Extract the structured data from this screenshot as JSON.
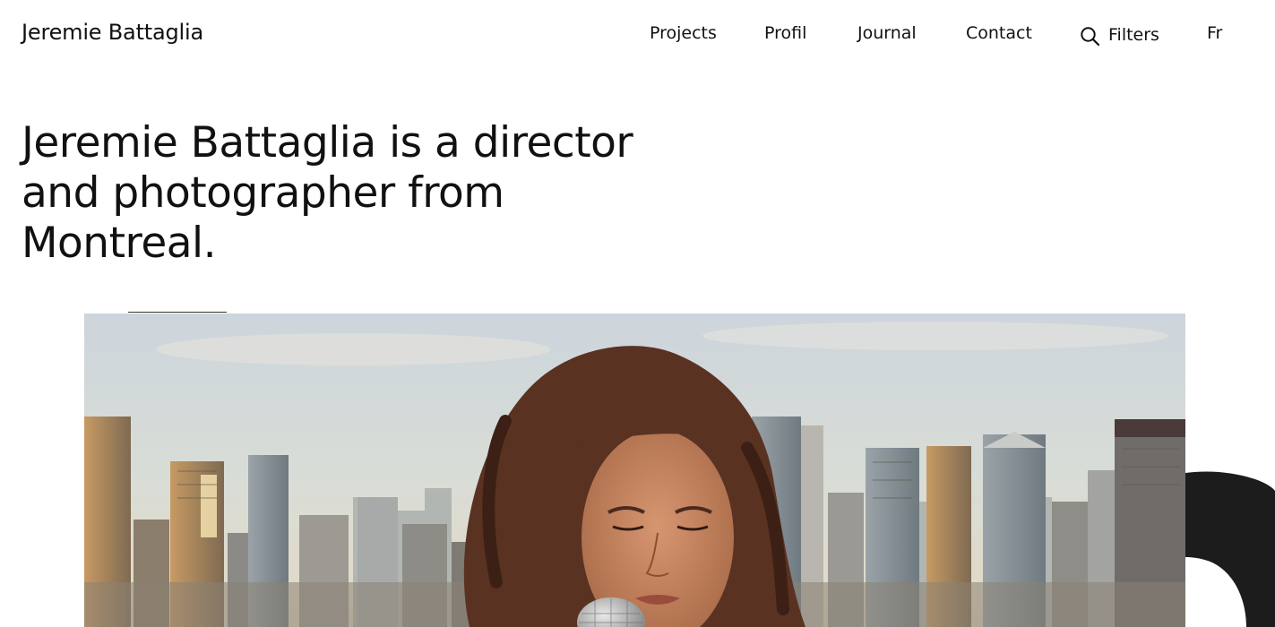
{
  "header": {
    "logo": "Jeremie Battaglia",
    "nav": {
      "projects": "Projects",
      "profil": "Profil",
      "journal": "Journal",
      "contact": "Contact",
      "filters": "Filters",
      "language": "Fr"
    },
    "icons": {
      "filters": "search-icon"
    }
  },
  "intro": {
    "text": "Jeremie Battaglia is a director and photographer from Montreal."
  },
  "colors": {
    "text": "#111111",
    "background": "#ffffff",
    "accent_shape": "#1c1c1c"
  }
}
